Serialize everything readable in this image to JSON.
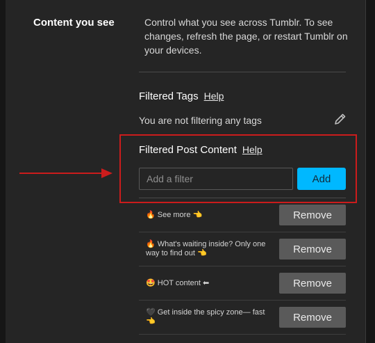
{
  "accent_color": "#00b8ff",
  "highlight_color": "#cc1c1c",
  "section": {
    "title": "Content you see",
    "description": "Control what you see across Tumblr. To see changes, refresh the page, or restart Tumblr on your devices."
  },
  "filtered_tags": {
    "title": "Filtered Tags",
    "help_label": "Help",
    "empty_message": "You are not filtering any tags",
    "edit_icon": "pencil-icon"
  },
  "filtered_post_content": {
    "title": "Filtered Post Content",
    "help_label": "Help",
    "input_placeholder": "Add a filter",
    "input_value": "",
    "add_label": "Add"
  },
  "filters": [
    {
      "text": "🔥 See more 👈",
      "remove_label": "Remove"
    },
    {
      "text": "🔥 What's waiting inside? Only one way to find out 👈",
      "remove_label": "Remove"
    },
    {
      "text": "🤩 HOT content ⬅",
      "remove_label": "Remove"
    },
    {
      "text": "🖤 Get inside the spicy zone— fast 👈",
      "remove_label": "Remove"
    }
  ]
}
